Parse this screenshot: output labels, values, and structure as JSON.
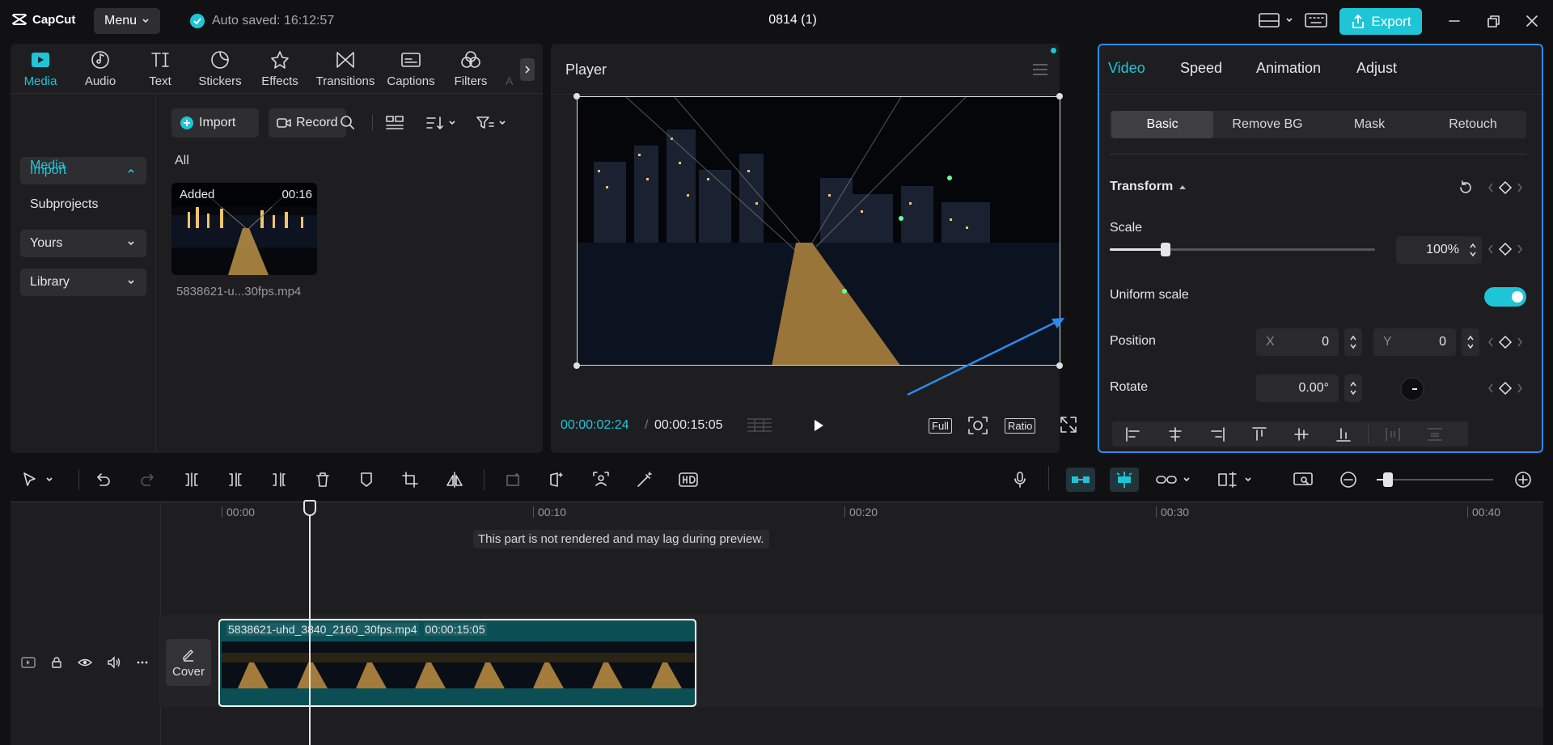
{
  "app": {
    "logo": "CapCut",
    "menu_label": "Menu",
    "autosave_text": "Auto saved: 16:12:57",
    "project_title": "0814 (1)",
    "export_label": "Export"
  },
  "toolbar": {
    "tools": [
      {
        "label": "Media",
        "icon": "media-icon",
        "active": true
      },
      {
        "label": "Audio",
        "icon": "audio-icon"
      },
      {
        "label": "Text",
        "icon": "text-icon"
      },
      {
        "label": "Stickers",
        "icon": "stickers-icon"
      },
      {
        "label": "Effects",
        "icon": "effects-icon"
      },
      {
        "label": "Transitions",
        "icon": "transitions-icon"
      },
      {
        "label": "Captions",
        "icon": "captions-icon"
      },
      {
        "label": "Filters",
        "icon": "filters-icon"
      }
    ],
    "overflow_partial_label": "A"
  },
  "sidebar": {
    "import_label": "Import",
    "media_label": "Media",
    "subprojects_label": "Subprojects",
    "yours_label": "Yours",
    "library_label": "Library"
  },
  "media": {
    "import_button": "Import",
    "record_button": "Record",
    "filter_label": "All",
    "clip": {
      "badge": "Added",
      "duration": "00:16",
      "filename": "5838621-u...30fps.mp4"
    }
  },
  "player": {
    "title": "Player",
    "current_time": "00:00:02:24",
    "separator": "/",
    "total_time": "00:00:15:05",
    "full_label": "Full",
    "ratio_label": "Ratio"
  },
  "properties": {
    "tabs": [
      "Video",
      "Speed",
      "Animation",
      "Adjust"
    ],
    "active_tab": "Video",
    "subtabs": [
      "Basic",
      "Remove BG",
      "Mask",
      "Retouch"
    ],
    "active_subtab": "Basic",
    "transform_label": "Transform",
    "scale_label": "Scale",
    "scale_value": "100%",
    "scale_slider_fraction": 0.21,
    "uniform_scale_label": "Uniform scale",
    "uniform_scale_on": true,
    "position_label": "Position",
    "pos_x_label": "X",
    "pos_x_value": "0",
    "pos_y_label": "Y",
    "pos_y_value": "0",
    "rotate_label": "Rotate",
    "rotate_value": "0.00°"
  },
  "timeline": {
    "ruler_labels": [
      "00:00",
      "00:10",
      "00:20",
      "00:30",
      "00:40"
    ],
    "render_notice": "This part is not rendered and may lag during preview.",
    "cover_label": "Cover",
    "clip_name": "5838621-uhd_3840_2160_30fps.mp4",
    "clip_duration": "00:00:15:05"
  },
  "colors": {
    "accent": "#1ec5d6",
    "selection_border": "#2d8bea",
    "clip_bg": "#0b4f55"
  }
}
